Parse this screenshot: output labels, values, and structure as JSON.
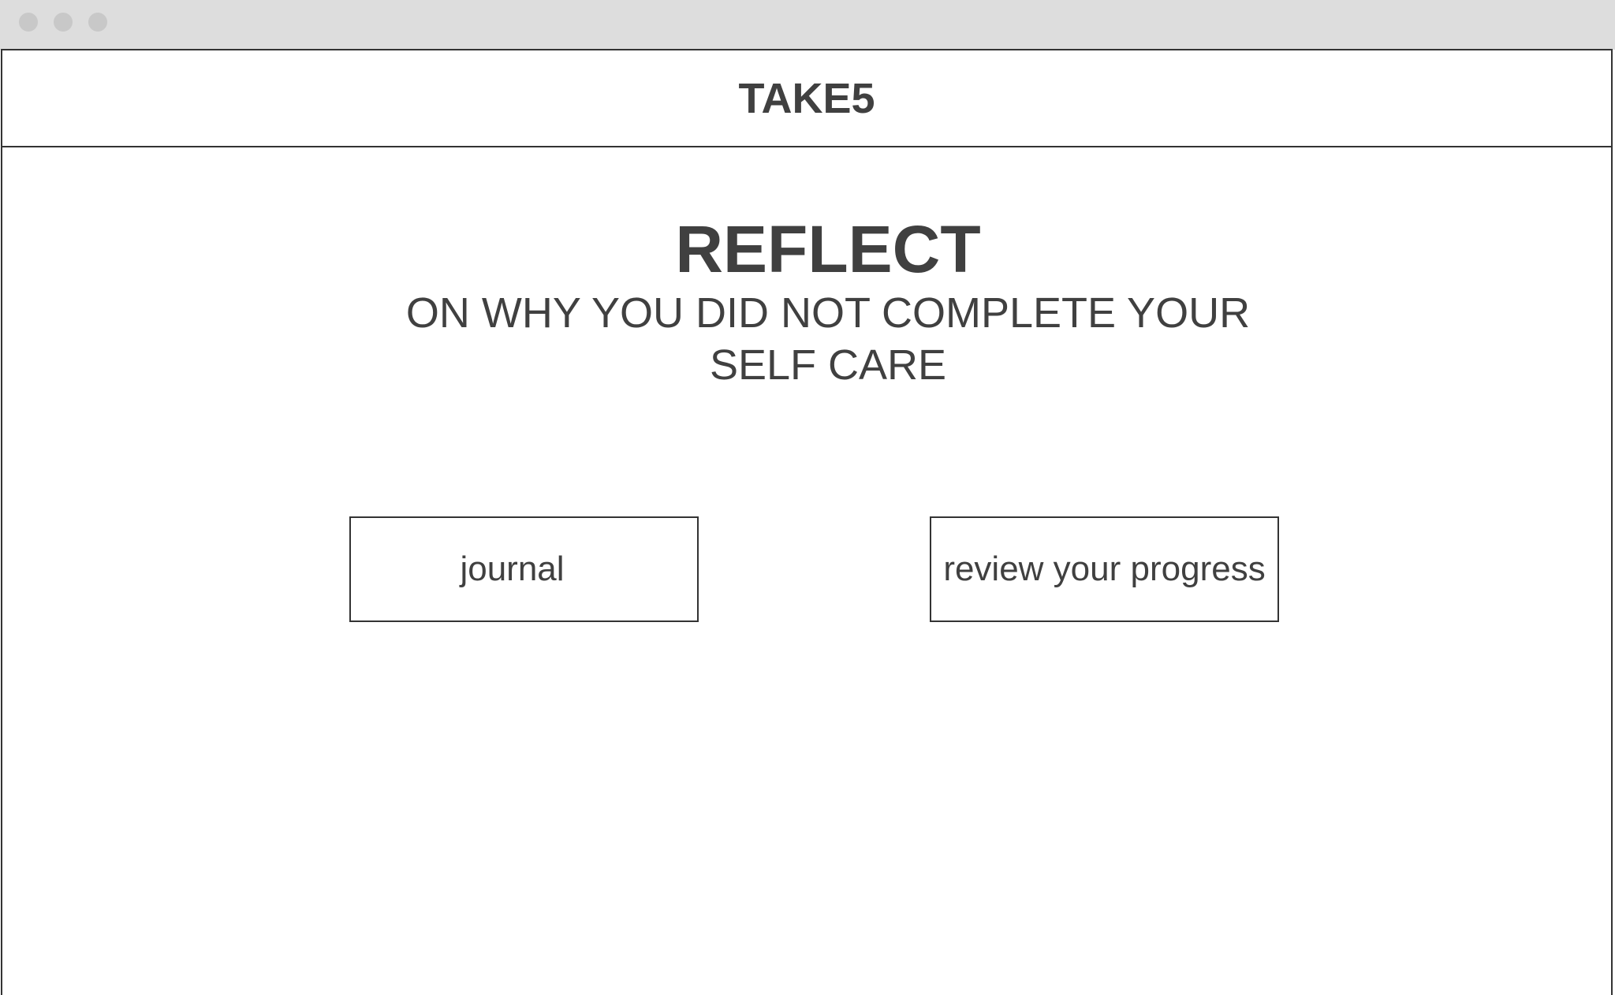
{
  "app": {
    "brand": "TAKE5"
  },
  "hero": {
    "title": "REFLECT",
    "subtitle": "ON WHY YOU DID NOT COMPLETE YOUR SELF CARE"
  },
  "actions": {
    "journal_label": "journal",
    "review_label": "review your progress"
  },
  "colors": {
    "text": "#404040",
    "border": "#333333",
    "titlebar": "#dddddd"
  }
}
